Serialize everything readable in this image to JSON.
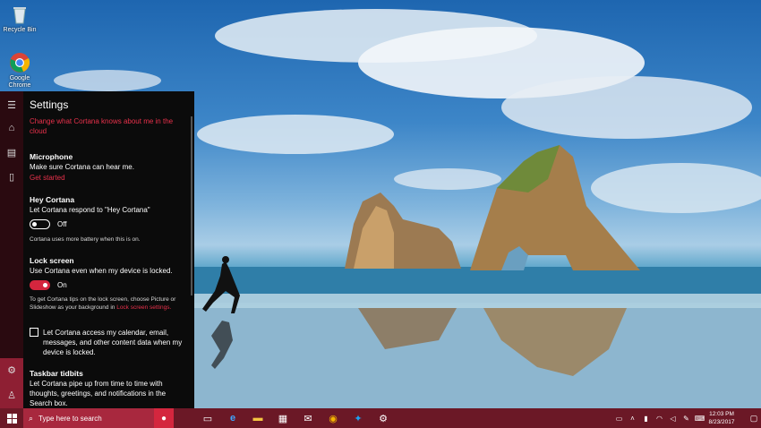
{
  "desktop": {
    "icons": [
      {
        "label": "Recycle Bin",
        "icon": "recycle-bin-icon"
      },
      {
        "label": "Google Chrome",
        "icon": "chrome-icon"
      }
    ]
  },
  "cortana": {
    "strip_icons": [
      "hamburger-menu-icon",
      "home-icon",
      "notebook-icon",
      "feedback-icon",
      "settings-gear-icon",
      "feedback-person-icon"
    ],
    "settings": {
      "title": "Settings",
      "knows_link": "Change what Cortana knows about me in the cloud",
      "microphone": {
        "heading": "Microphone",
        "description": "Make sure Cortana can hear me.",
        "link": "Get started"
      },
      "hey_cortana": {
        "heading": "Hey Cortana",
        "description": "Let Cortana respond to \"Hey Cortana\"",
        "toggle_state": "Off",
        "note": "Cortana uses more battery when this is on."
      },
      "lock_screen": {
        "heading": "Lock screen",
        "description": "Use Cortana even when my device is locked.",
        "toggle_state": "On",
        "note": "To get Cortana tips on the lock screen, choose Picture or Slideshow as your background in",
        "note_link": "Lock screen settings.",
        "checkbox_label": "Let Cortana access my calendar, email, messages, and other content data when my device is locked."
      },
      "taskbar_tidbits": {
        "heading": "Taskbar tidbits",
        "description": "Let Cortana pipe up from time to time with thoughts, greetings, and notifications in the Search box."
      }
    }
  },
  "taskbar": {
    "search_placeholder": "Type here to search",
    "apps": [
      "task-view-icon",
      "edge-icon",
      "file-explorer-icon",
      "store-icon",
      "mail-icon",
      "chrome-icon",
      "twitter-icon",
      "settings-icon"
    ],
    "tray_icons": [
      "action-center-icon",
      "chevron-up-icon",
      "battery-icon",
      "network-icon",
      "volume-icon",
      "pen-icon",
      "keyboard-icon"
    ],
    "time": "12:03 PM",
    "date": "8/23/2017"
  },
  "colors": {
    "accent": "#d4263e",
    "taskbar": "#6b1826",
    "panel": "#0b0b0b"
  }
}
